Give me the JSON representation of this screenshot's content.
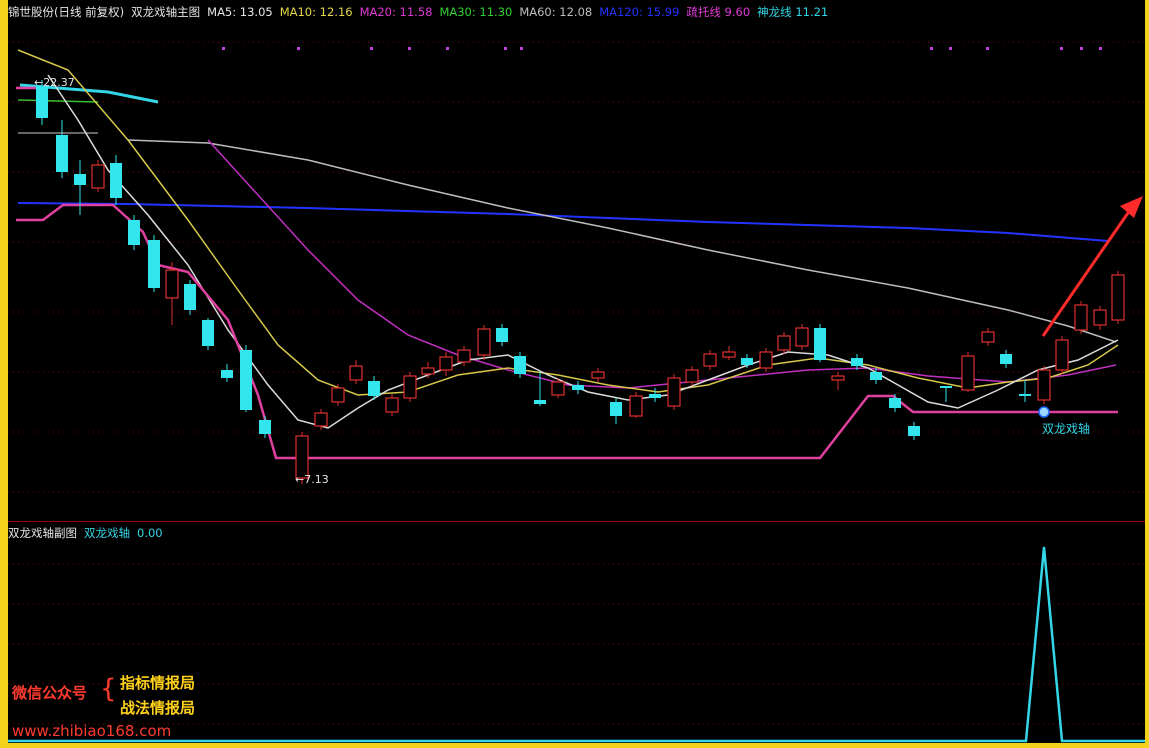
{
  "main": {
    "security": "锦世股份(日线 前复权)",
    "indicator": "双龙戏轴主图",
    "ma": [
      {
        "label": "MA5:",
        "value": "13.05",
        "color": "#e6e6e6"
      },
      {
        "label": "MA10:",
        "value": "12.16",
        "color": "#e6d84a"
      },
      {
        "label": "MA20:",
        "value": "11.58",
        "color": "#e03ad6"
      },
      {
        "label": "MA30:",
        "value": "11.30",
        "color": "#33d033"
      },
      {
        "label": "MA60:",
        "value": "12.08",
        "color": "#bdbdbd"
      },
      {
        "label": "MA120:",
        "value": "15.99",
        "color": "#2233ff"
      },
      {
        "label": "疏托线",
        "value": "9.60",
        "color": "#e03ad6"
      },
      {
        "label": "神龙线",
        "value": "11.21",
        "color": "#33d6e6"
      }
    ],
    "high_marker": "22.37",
    "low_marker": "←7.13",
    "signal_label": "双龙戏轴"
  },
  "sub": {
    "indicator": "双龙戏轴副图",
    "series_label": "双龙戏轴",
    "series_value": "0.00"
  },
  "watermark": {
    "wechat": "微信公众号",
    "brace": "{",
    "line1": "指标情报局",
    "line2": "战法情报局",
    "url": "www.zhibiao168.com"
  },
  "colors": {
    "background": "#000000",
    "frame": "#f2d21a",
    "grid": "#8a0000",
    "up": "#e03030",
    "down": "#33e6ee",
    "arrow": "#ff2a2a"
  }
}
